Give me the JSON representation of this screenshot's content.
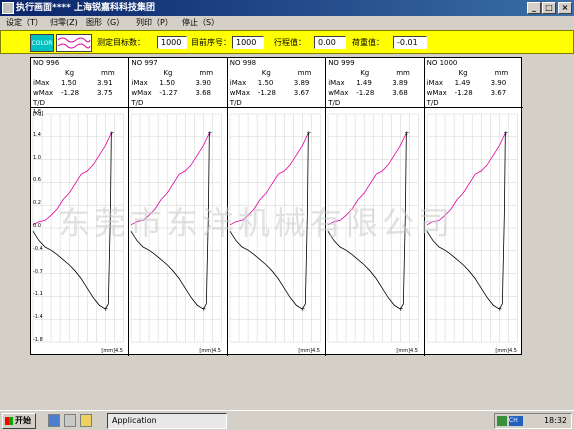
{
  "window": {
    "title": "执行画面**** 上海锐嘉科科技集团"
  },
  "menu": [
    {
      "label": "设定（T）"
    },
    {
      "label": "归零(Z)"
    },
    {
      "label": "图形（G）"
    },
    {
      "label": "列印（P）"
    },
    {
      "label": "停止（S）"
    }
  ],
  "toolbar": {
    "color_label": "COLOR",
    "target_count_label": "测定目标数：",
    "target_count_value": "1000",
    "current_seq_label": "目前序号：",
    "current_seq_value": "1000",
    "stroke_label": "行程值：",
    "stroke_value": "0.00",
    "load_label": "荷重值：",
    "load_value": "-0.01"
  },
  "panels": [
    {
      "no": "NO  996",
      "unit_kg": "Kg",
      "unit_mm": "mm",
      "imax_label": "iMax",
      "imax_kg": "1.50",
      "imax_mm": "3.91",
      "wmax_label": "wMax",
      "wmax_kg": "-1.28",
      "wmax_mm": "3.75",
      "td": "T/D"
    },
    {
      "no": "NO  997",
      "unit_kg": "Kg",
      "unit_mm": "mm",
      "imax_label": "iMax",
      "imax_kg": "1.50",
      "imax_mm": "3.90",
      "wmax_label": "wMax",
      "wmax_kg": "-1.27",
      "wmax_mm": "3.68",
      "td": "T/D"
    },
    {
      "no": "NO  998",
      "unit_kg": "Kg",
      "unit_mm": "mm",
      "imax_label": "iMax",
      "imax_kg": "1.50",
      "imax_mm": "3.89",
      "wmax_label": "wMax",
      "wmax_kg": "-1.28",
      "wmax_mm": "3.67",
      "td": "T/D"
    },
    {
      "no": "NO  999",
      "unit_kg": "Kg",
      "unit_mm": "mm",
      "imax_label": "iMax",
      "imax_kg": "1.49",
      "imax_mm": "3.89",
      "wmax_label": "wMax",
      "wmax_kg": "-1.28",
      "wmax_mm": "3.68",
      "td": "T/D"
    },
    {
      "no": "NO  1000",
      "unit_kg": "Kg",
      "unit_mm": "mm",
      "imax_label": "iMax",
      "imax_kg": "1.49",
      "imax_mm": "3.90",
      "wmax_label": "wMax",
      "wmax_kg": "-1.28",
      "wmax_mm": "3.67",
      "td": "T/D"
    }
  ],
  "chart_data": {
    "type": "line",
    "ylabel": "[Kg]",
    "xlabel": "[mm]",
    "x_end_label": "4.5",
    "ylim": [
      -1.8,
      1.8
    ],
    "xlim": [
      0,
      4.5
    ],
    "y_ticks": [
      "1.8",
      "1.4",
      "1.0",
      "0.6",
      "0.2",
      "0.0",
      "-0.4",
      "-0.7",
      "-1.1",
      "-1.4",
      "-1.8"
    ],
    "grid": true,
    "series": [
      {
        "color": "#e000a0",
        "x": [
          0.0,
          0.3,
          0.6,
          0.9,
          1.2,
          1.5,
          1.8,
          2.1,
          2.4,
          2.7,
          3.0,
          3.3,
          3.6,
          3.9
        ],
        "y": [
          0.05,
          0.1,
          0.12,
          0.2,
          0.3,
          0.45,
          0.55,
          0.7,
          0.85,
          0.9,
          1.0,
          1.15,
          1.3,
          1.5
        ]
      },
      {
        "color": "#000000",
        "x": [
          0.0,
          0.3,
          0.6,
          0.9,
          1.2,
          1.5,
          1.8,
          2.1,
          2.4,
          2.7,
          3.0,
          3.3,
          3.6,
          3.75,
          3.85,
          3.9
        ],
        "y": [
          -0.05,
          -0.2,
          -0.3,
          -0.35,
          -0.42,
          -0.5,
          -0.58,
          -0.68,
          -0.8,
          -0.95,
          -1.1,
          -1.22,
          -1.28,
          -1.2,
          0.2,
          1.5
        ]
      }
    ]
  },
  "watermark": "东莞市东洋机械有限公司",
  "taskbar": {
    "start_label": "开始",
    "app_label": "Application",
    "ime_label": "CH",
    "clock": "18:32"
  }
}
